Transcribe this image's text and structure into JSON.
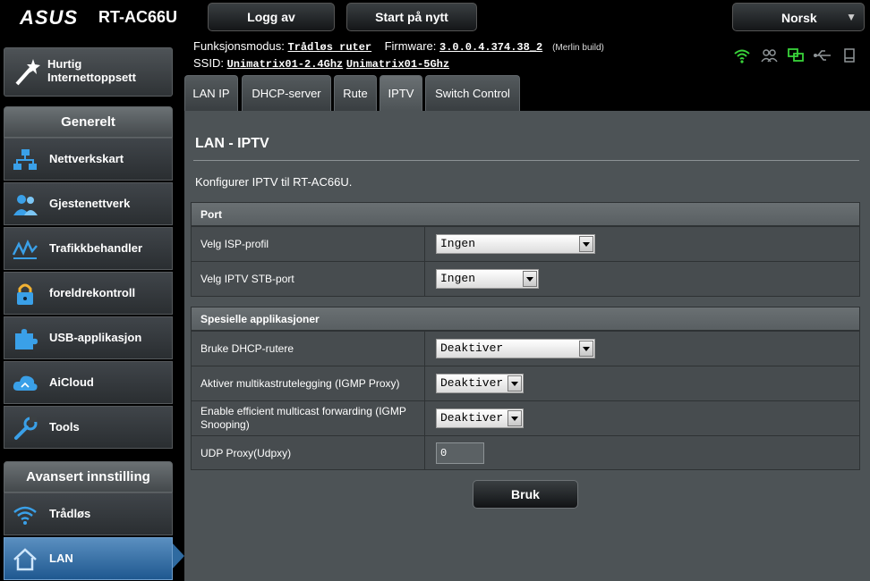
{
  "brand": {
    "logo": "ASUS",
    "model": "RT-AC66U"
  },
  "topbar": {
    "logout_label": "Logg av",
    "restart_label": "Start på nytt",
    "language": "Norsk"
  },
  "info": {
    "mode_label": "Funksjonsmodus:",
    "mode_value": "Trådløs ruter",
    "firmware_label": "Firmware:",
    "firmware_value": "3.0.0.4.374.38_2",
    "firmware_note": "(Merlin build)",
    "ssid_label": "SSID:",
    "ssid_1": "Unimatrix01-2.4Ghz",
    "ssid_2": "Unimatrix01-5Ghz"
  },
  "status_icons": [
    "wifi-icon",
    "users-icon",
    "network-icon",
    "usb-icon",
    "printer-icon"
  ],
  "sidebar": {
    "quick_setup": "Hurtig Internettoppsett",
    "general_header": "Generelt",
    "general_items": [
      {
        "label": "Nettverkskart",
        "icon": "network-map-icon"
      },
      {
        "label": "Gjestenettverk",
        "icon": "guest-network-icon"
      },
      {
        "label": "Trafikkbehandler",
        "icon": "traffic-icon"
      },
      {
        "label": "foreldrekontroll",
        "icon": "lock-icon"
      },
      {
        "label": "USB-applikasjon",
        "icon": "puzzle-icon"
      },
      {
        "label": "AiCloud",
        "icon": "cloud-icon"
      },
      {
        "label": "Tools",
        "icon": "wrench-icon"
      }
    ],
    "advanced_header": "Avansert innstilling",
    "advanced_items": [
      {
        "label": "Trådløs",
        "icon": "wifi-icon"
      },
      {
        "label": "LAN",
        "icon": "home-icon"
      }
    ]
  },
  "tabs": [
    "LAN IP",
    "DHCP-server",
    "Rute",
    "IPTV",
    "Switch Control"
  ],
  "active_tab": "IPTV",
  "page": {
    "title": "LAN - IPTV",
    "description": "Konfigurer IPTV til RT-AC66U."
  },
  "port_section": {
    "header": "Port",
    "rows": [
      {
        "label": "Velg ISP-profil",
        "value": "Ingen"
      },
      {
        "label": "Velg IPTV STB-port",
        "value": "Ingen"
      }
    ]
  },
  "special_section": {
    "header": "Spesielle applikasjoner",
    "rows": [
      {
        "label": "Bruke DHCP-rutere",
        "value": "Deaktiver"
      },
      {
        "label": "Aktiver multikastrutelegging (IGMP Proxy)",
        "value": "Deaktiver"
      },
      {
        "label": "Enable efficient multicast forwarding (IGMP Snooping)",
        "value": "Deaktiver"
      },
      {
        "label": "UDP Proxy(Udpxy)",
        "value": "0"
      }
    ]
  },
  "apply_label": "Bruk"
}
